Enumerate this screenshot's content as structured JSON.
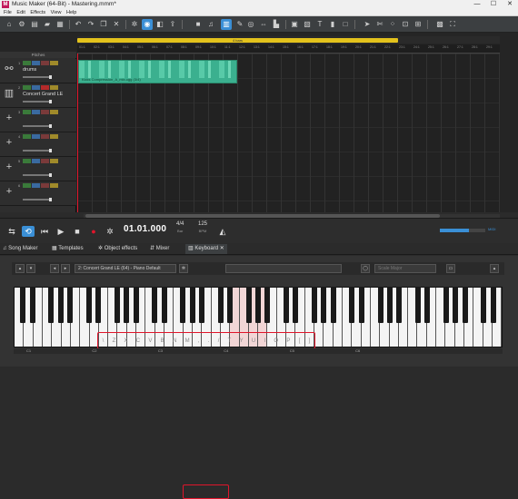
{
  "window": {
    "title": "Music Maker (64-Bit) - Mastering.mmm*",
    "app_icon": "M",
    "controls": [
      "—",
      "☐",
      "✕"
    ]
  },
  "menu": [
    "File",
    "Edit",
    "Effects",
    "View",
    "Help"
  ],
  "arranger": {
    "range_label": "4 bars",
    "pitches_label": "Pitches",
    "ruler": [
      "01:1",
      "02:1",
      "03:1",
      "04:1",
      "05:1",
      "06:1",
      "07:1",
      "08:1",
      "09:1",
      "10:1",
      "11:1",
      "12:1",
      "13:1",
      "14:1",
      "15:1",
      "16:1",
      "17:1",
      "18:1",
      "19:1",
      "20:1",
      "21:1",
      "22:1",
      "23:1",
      "24:1",
      "25:1",
      "26:1",
      "27:1",
      "28:1",
      "29:1"
    ],
    "tracks": [
      {
        "num": "1",
        "name": "drums",
        "icon": "drums-icon"
      },
      {
        "num": "2",
        "name": "Concert Grand LE",
        "icon": "piano-icon"
      },
      {
        "num": "3",
        "name": "",
        "icon": "plus-icon"
      },
      {
        "num": "4",
        "name": "",
        "icon": "plus-icon"
      },
      {
        "num": "5",
        "name": "",
        "icon": "plus-icon"
      },
      {
        "num": "6",
        "name": "",
        "icon": "plus-icon"
      }
    ],
    "clip_label": "Kicks Compression_A_mix.ogg (3/4)"
  },
  "transport": {
    "time": "01.01.000",
    "signature": "4/4",
    "signature_label": "Bar",
    "bpm": "125",
    "bpm_label": "BPM",
    "volume_label": "MIDI"
  },
  "tabs": [
    {
      "label": "Song Maker"
    },
    {
      "label": "Templates"
    },
    {
      "label": "Object effects"
    },
    {
      "label": "Mixer"
    },
    {
      "label": "Keyboard",
      "selected": true
    }
  ],
  "keyboard_panel": {
    "preset": "2: Concert Grand LE (64) - Piano Default",
    "scale": "Scale Major",
    "key_labels": [
      "\\",
      "Z",
      "X",
      "C",
      "V",
      "B",
      "N",
      "M",
      ",",
      ".",
      "/",
      "T",
      "Y",
      "U",
      "I",
      "O",
      "P",
      "[",
      "]"
    ],
    "octave_labels": [
      "C1",
      "C2",
      "C3",
      "C4",
      "C5",
      "C6"
    ]
  },
  "colors": {
    "accent": "#3a8fd6",
    "highlight": "#e0152b",
    "clip": "#3bb08f",
    "range": "#e3c21c"
  }
}
